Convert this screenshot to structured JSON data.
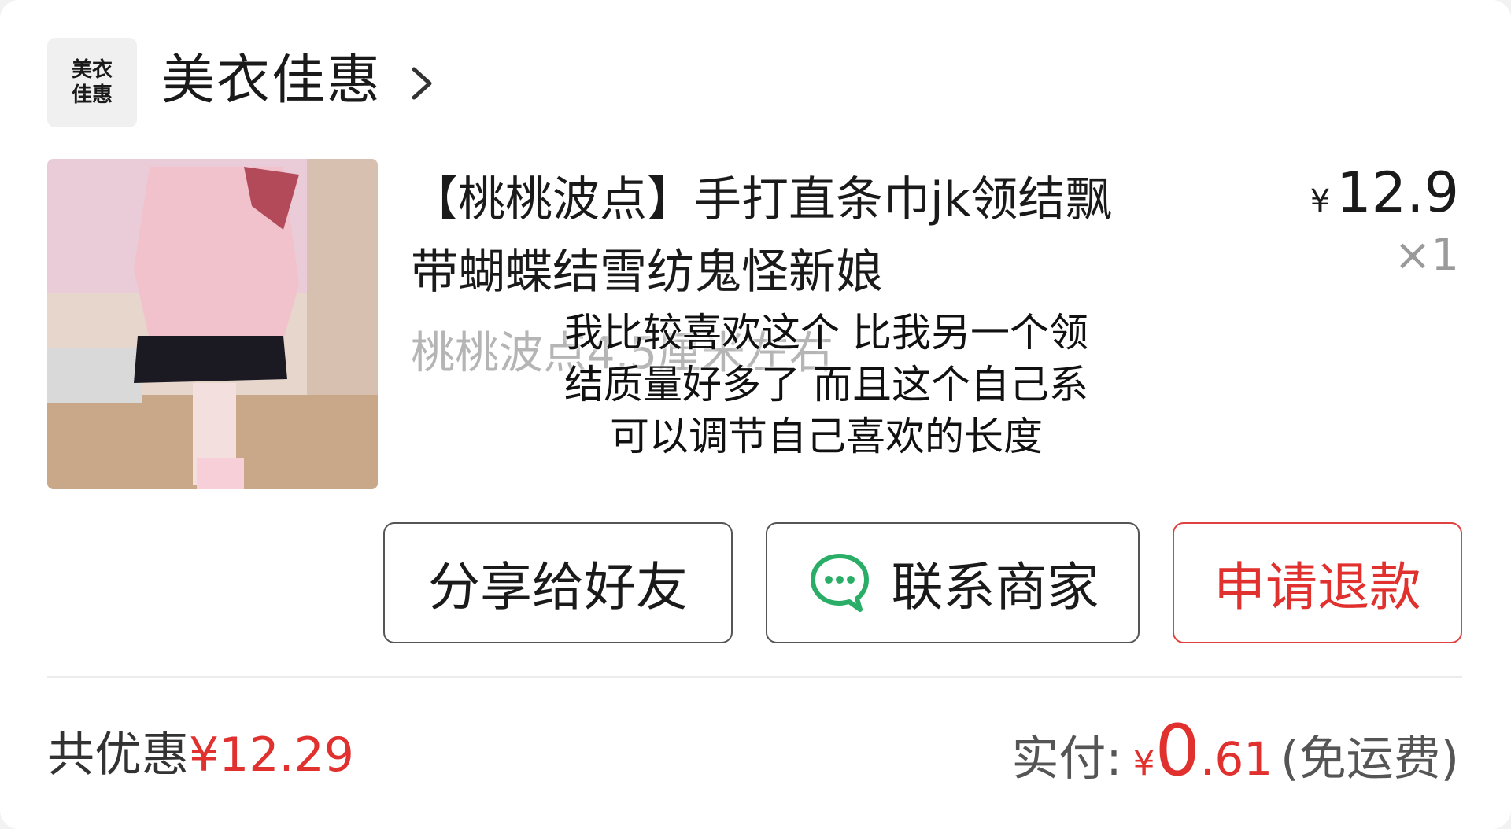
{
  "shop": {
    "logo_line1": "美衣",
    "logo_line2": "佳惠",
    "name": "美衣佳惠"
  },
  "product": {
    "title_line1": "【桃桃波点】手打直条巾jk领结飘",
    "title_line2": "带蝴蝶结雪纺鬼怪新娘",
    "price_currency": "¥",
    "price": "12.9",
    "quantity": "×1",
    "spec": "桃桃波点4.5厘米左右"
  },
  "caption": {
    "line1": "我比较喜欢这个  比我另一个领",
    "line2": "结质量好多了  而且这个自己系",
    "line3": "可以调节自己喜欢的长度"
  },
  "actions": {
    "share_label": "分享给好友",
    "contact_label": "联系商家",
    "refund_label": "申请退款"
  },
  "summary": {
    "discount_label": "共优惠",
    "discount_amount": "¥12.29",
    "paid_label": "实付:",
    "paid_currency": "¥",
    "paid_int": "0",
    "paid_dec": ".61",
    "shipping_note": "(免运费)"
  },
  "colors": {
    "accent_red": "#e0312f",
    "wechat_green": "#2aae67"
  },
  "icons": {
    "shop_chevron": "chevron-right-icon",
    "contact": "chat-bubble-icon"
  }
}
